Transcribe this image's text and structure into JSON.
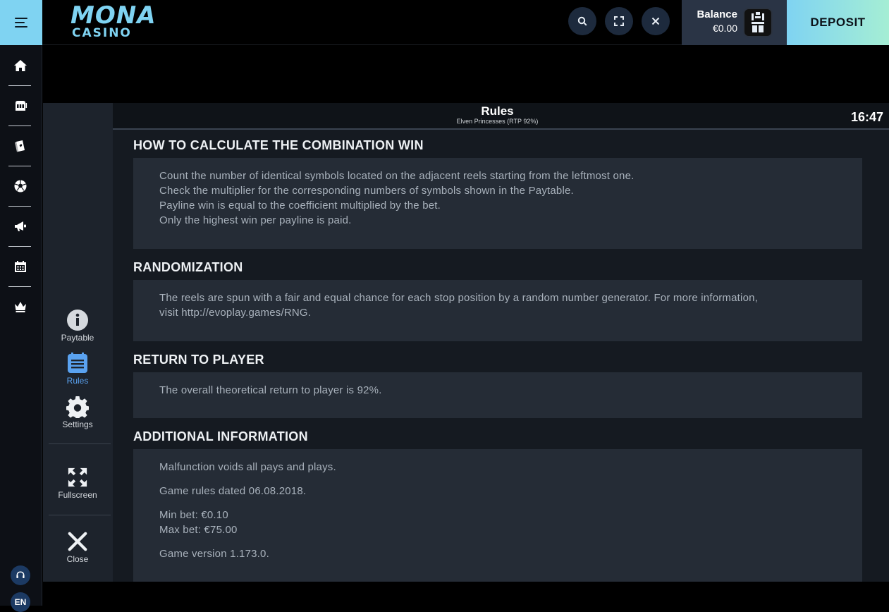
{
  "topbar": {
    "logo_line1": "MONA",
    "logo_line2": "CASINO",
    "balance_label": "Balance",
    "balance_value": "€0.00",
    "deposit_label": "DEPOSIT"
  },
  "left_rail": {
    "items": [
      {
        "icon": "home-icon"
      },
      {
        "icon": "slot-machine-icon"
      },
      {
        "icon": "cards-icon"
      },
      {
        "icon": "soccer-ball-icon"
      },
      {
        "icon": "megaphone-icon"
      },
      {
        "icon": "calendar-icon"
      },
      {
        "icon": "crown-icon"
      }
    ],
    "language": "EN"
  },
  "game": {
    "sidebar": {
      "paytable": "Paytable",
      "rules": "Rules",
      "settings": "Settings",
      "fullscreen": "Fullscreen",
      "close": "Close"
    },
    "header": {
      "title": "Rules",
      "subtitle": "Elven Princesses (RTP 92%)",
      "time": "16:47"
    },
    "sections": {
      "combination": {
        "title": "HOW TO CALCULATE THE COMBINATION WIN",
        "lines": [
          "Count the number of identical symbols located on the adjacent reels starting from the leftmost one.",
          "Check the multiplier for the corresponding numbers of symbols shown in the Paytable.",
          "Payline win is equal to the coefficient multiplied by the bet.",
          "Only the highest win per payline is paid."
        ]
      },
      "randomization": {
        "title": "RANDOMIZATION",
        "line1": "The reels are spun with a fair and equal chance for each stop position by a random number generator. For more information,",
        "line2": "visit http://evoplay.games/RNG."
      },
      "rtp": {
        "title": "RETURN TO PLAYER",
        "text": "The overall theoretical return to player is 92%."
      },
      "additional": {
        "title": "ADDITIONAL INFORMATION",
        "malfunction": "Malfunction voids all pays and plays.",
        "rules_date": "Game rules dated 06.08.2018.",
        "min_bet": "Min bet: €0.10",
        "max_bet": "Max bet: €75.00",
        "version": "Game version 1.173.0."
      }
    }
  },
  "colors": {
    "accent": "#7fd3f2",
    "active_tool": "#5aa2f0",
    "panel": "#252c36"
  }
}
